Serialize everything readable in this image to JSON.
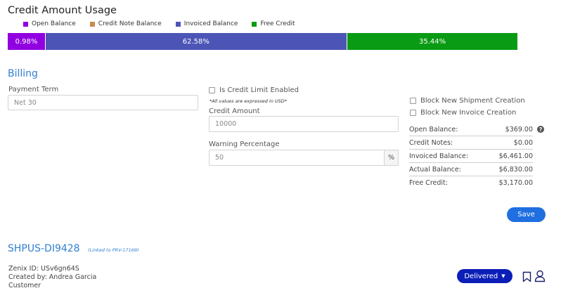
{
  "credit_usage": {
    "title": "Credit Amount Usage",
    "legend": [
      {
        "label": "Open Balance",
        "color": "#9100e0"
      },
      {
        "label": "Credit Note Balance",
        "color": "#c98a4f"
      },
      {
        "label": "Invoiced Balance",
        "color": "#4c55b6"
      },
      {
        "label": "Free Credit",
        "color": "#0a9b14"
      }
    ],
    "segments": [
      {
        "name": "Open Balance",
        "percent": 0.98,
        "label": "0.98%"
      },
      {
        "name": "Invoiced Balance",
        "percent": 62.58,
        "label": "62.58%"
      },
      {
        "name": "Free Credit",
        "percent": 35.44,
        "label": "35.44%"
      }
    ]
  },
  "billing": {
    "title": "Billing",
    "payment_term_label": "Payment Term",
    "payment_term_value": "Net 30",
    "credit_limit_enabled_label": "Is Credit Limit Enabled",
    "usd_note": "*All values are expressed in USD*",
    "credit_amount_label": "Credit Amount",
    "credit_amount_placeholder": "10000",
    "warning_percentage_label": "Warning Percentage",
    "warning_percentage_placeholder": "50",
    "percent_addon": "%",
    "block_shipment_label": "Block New Shipment Creation",
    "block_invoice_label": "Block New Invoice Creation",
    "summary": {
      "open_balance_label": "Open Balance:",
      "open_balance_value": "$369.00",
      "credit_notes_label": "Credit Notes:",
      "credit_notes_value": "$0.00",
      "invoiced_balance_label": "Invoiced Balance:",
      "invoiced_balance_value": "$6,461.00",
      "actual_balance_label": "Actual Balance:",
      "actual_balance_value": "$6,830.00",
      "free_credit_label": "Free Credit:",
      "free_credit_value": "$3,170.00"
    },
    "help_icon": "?",
    "save_label": "Save"
  },
  "shipment": {
    "id": "SHPUS-DI9428",
    "linked_note": "(Linked to PRV-17169)",
    "zenix_id": "Zenix ID: USv6gn64S",
    "created_by": "Created by: Andrea Garcia",
    "role": "Customer",
    "status_label": "Delivered",
    "bookmark_icon": "bookmark-icon",
    "user_icon": "user-icon"
  }
}
